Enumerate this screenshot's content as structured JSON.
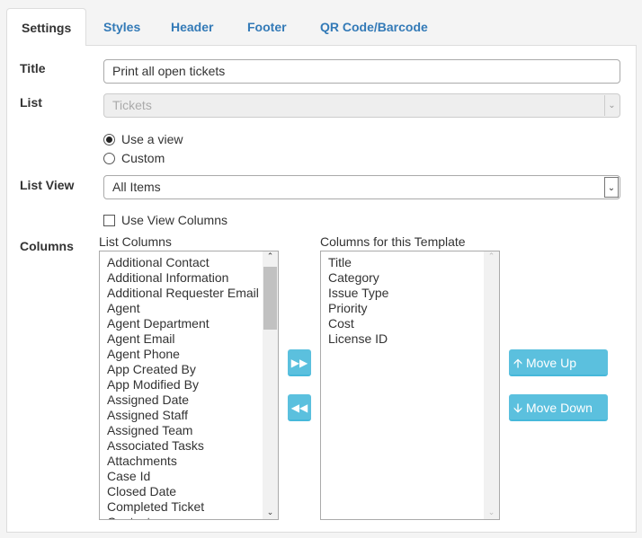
{
  "tabs": [
    {
      "label": "Settings",
      "active": true
    },
    {
      "label": "Styles"
    },
    {
      "label": "Header"
    },
    {
      "label": "Footer"
    },
    {
      "label": "QR Code/Barcode"
    }
  ],
  "form": {
    "title_label": "Title",
    "title_value": "Print all open tickets",
    "list_label": "List",
    "list_value": "Tickets",
    "radio_view": "Use a view",
    "radio_custom": "Custom",
    "list_view_label": "List View",
    "list_view_value": "All Items",
    "use_view_columns": "Use View Columns",
    "columns_label": "Columns",
    "list_columns_label": "List Columns",
    "template_columns_label": "Columns for this Template"
  },
  "list_columns": [
    "Additional Contact",
    "Additional Information",
    "Additional Requester Email",
    "Agent",
    "Agent Department",
    "Agent Email",
    "Agent Phone",
    "App Created By",
    "App Modified By",
    "Assigned Date",
    "Assigned Staff",
    "Assigned Team",
    "Associated Tasks",
    "Attachments",
    "Case Id",
    "Closed Date",
    "Completed Ticket",
    "Contact"
  ],
  "template_columns": [
    "Title",
    "Category",
    "Issue Type",
    "Priority",
    "Cost",
    "License ID"
  ],
  "buttons": {
    "move_up": "Move Up",
    "move_down": "Move Down"
  },
  "colors": {
    "accent": "#5bc0de",
    "link": "#337ab7"
  }
}
